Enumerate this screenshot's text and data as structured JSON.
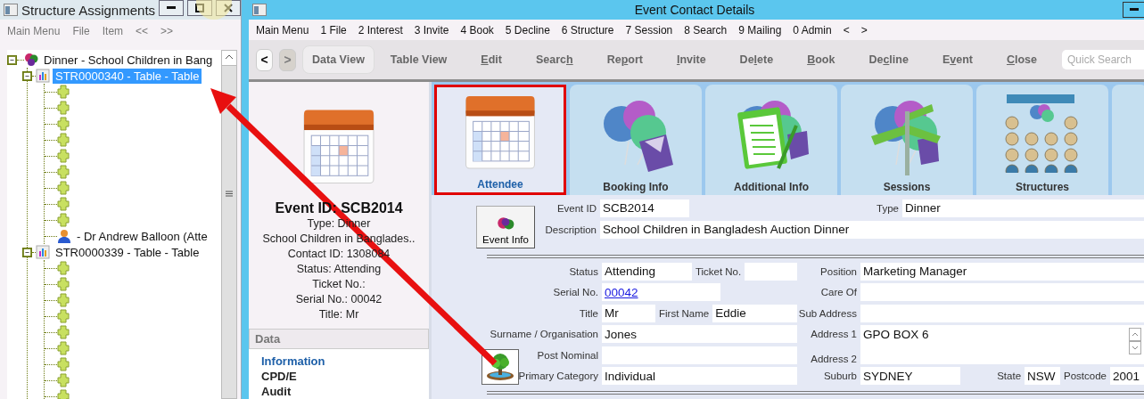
{
  "structure_window": {
    "title": "Structure Assignments",
    "menu": [
      "Main Menu",
      "File",
      "Item",
      "<<",
      ">>"
    ],
    "tree": [
      {
        "kind": "event",
        "label": "Dinner - School Children in Bang",
        "expanded": true,
        "selected": false,
        "children": [
          {
            "kind": "table",
            "label": "STR0000340 - Table - Table",
            "expanded": true,
            "selected": true,
            "children": [
              {
                "kind": "seat"
              },
              {
                "kind": "seat"
              },
              {
                "kind": "seat"
              },
              {
                "kind": "seat"
              },
              {
                "kind": "seat"
              },
              {
                "kind": "seat"
              },
              {
                "kind": "seat"
              },
              {
                "kind": "seat"
              },
              {
                "kind": "seat"
              },
              {
                "kind": "person",
                "label": "- Dr Andrew Balloon (Atte"
              }
            ]
          },
          {
            "kind": "table",
            "label": "STR0000339 - Table - Table",
            "expanded": true,
            "selected": false,
            "children": [
              {
                "kind": "seat"
              },
              {
                "kind": "seat"
              },
              {
                "kind": "seat"
              },
              {
                "kind": "seat"
              },
              {
                "kind": "seat"
              },
              {
                "kind": "seat"
              },
              {
                "kind": "seat"
              },
              {
                "kind": "seat"
              },
              {
                "kind": "seat"
              }
            ]
          }
        ]
      }
    ]
  },
  "window": {
    "title": "Event Contact Details"
  },
  "menu": [
    "Main Menu",
    "1 File",
    "2 Interest",
    "3 Invite",
    "4 Book",
    "5 Decline",
    "6 Structure",
    "7 Session",
    "8 Search",
    "9 Mailing",
    "0 Admin",
    "<",
    ">"
  ],
  "toolbar": {
    "nav": [
      {
        "label": "<",
        "disabled": false
      },
      {
        "label": ">",
        "disabled": true
      }
    ],
    "buttons": [
      {
        "parts": [
          {
            "text": "Data View",
            "underlined": false
          }
        ],
        "selected": true
      },
      {
        "parts": [
          {
            "text": "Table View",
            "underlined": false
          }
        ],
        "selected": false
      },
      {
        "parts": [
          {
            "text": "E",
            "underlined": true
          },
          {
            "text": "dit",
            "underlined": false
          }
        ],
        "selected": false
      },
      {
        "parts": [
          {
            "text": "Searc",
            "underlined": false
          },
          {
            "text": "h",
            "underlined": true
          }
        ],
        "selected": false
      },
      {
        "parts": [
          {
            "text": "Re",
            "underlined": false
          },
          {
            "text": "p",
            "underlined": true
          },
          {
            "text": "ort",
            "underlined": false
          }
        ],
        "selected": false
      },
      {
        "parts": [
          {
            "text": "I",
            "underlined": true
          },
          {
            "text": "nvite",
            "underlined": false
          }
        ],
        "selected": false
      },
      {
        "parts": [
          {
            "text": "De",
            "underlined": false
          },
          {
            "text": "l",
            "underlined": true
          },
          {
            "text": "ete",
            "underlined": false
          }
        ],
        "selected": false
      },
      {
        "parts": [
          {
            "text": "B",
            "underlined": true
          },
          {
            "text": "ook",
            "underlined": false
          }
        ],
        "selected": false
      },
      {
        "parts": [
          {
            "text": "De",
            "underlined": false
          },
          {
            "text": "c",
            "underlined": true
          },
          {
            "text": "line",
            "underlined": false
          }
        ],
        "selected": false
      },
      {
        "parts": [
          {
            "text": "E",
            "underlined": false
          },
          {
            "text": "v",
            "underlined": true
          },
          {
            "text": "ent",
            "underlined": false
          }
        ],
        "selected": false
      },
      {
        "parts": [
          {
            "text": "C",
            "underlined": true
          },
          {
            "text": "lose",
            "underlined": false
          }
        ],
        "selected": false
      }
    ],
    "quick_search": {
      "placeholder": "Quick Search"
    }
  },
  "summary": {
    "heading": "Event ID: SCB2014",
    "lines": [
      "Type: Dinner",
      "School Children in Banglades..",
      "Contact ID: 1308084",
      "Status: Attending",
      "Ticket No.:",
      "Serial No.: 00042",
      "Title: Mr"
    ]
  },
  "data_nav": {
    "title": "Data",
    "items": [
      {
        "label": "Information",
        "selected": true
      },
      {
        "label": "CPD/E",
        "selected": false
      },
      {
        "label": "Audit",
        "selected": false
      }
    ]
  },
  "tabs": [
    {
      "label": "Attendee",
      "kind": "calendar",
      "selected": true
    },
    {
      "label": "Booking Info",
      "kind": "balloons",
      "selected": false
    },
    {
      "label": "Additional Info",
      "kind": "clipboard",
      "selected": false
    },
    {
      "label": "Sessions",
      "kind": "signpost",
      "selected": false
    },
    {
      "label": "Structures",
      "kind": "seating",
      "selected": false
    }
  ],
  "event_info_button": {
    "label": "Event Info"
  },
  "form": {
    "event_id": {
      "label": "Event ID",
      "value": "SCB2014"
    },
    "type": {
      "label": "Type",
      "value": "Dinner"
    },
    "description": {
      "label": "Description",
      "value": "School Children in Bangladesh Auction Dinner"
    },
    "status": {
      "label": "Status",
      "value": "Attending"
    },
    "ticket_no": {
      "label": "Ticket No."
    },
    "serial_no": {
      "label": "Serial No.",
      "value": "00042"
    },
    "title": {
      "label": "Title",
      "value": "Mr"
    },
    "first_name": {
      "label": "First Name",
      "value": "Eddie"
    },
    "surname": {
      "label": "Surname / Organisation",
      "value": "Jones"
    },
    "post_nominal": {
      "label": "Post Nominal"
    },
    "primary_category": {
      "label": "Primary Category",
      "value": "Individual"
    },
    "position": {
      "label": "Position",
      "value": "Marketing Manager"
    },
    "care_of": {
      "label": "Care Of"
    },
    "sub_address": {
      "label": "Sub Address"
    },
    "address": {
      "label_1": "Address 1",
      "label_2": "Address 2",
      "value": "GPO BOX 6"
    },
    "suburb": {
      "label": "Suburb",
      "value": "SYDNEY"
    },
    "state": {
      "label": "State",
      "value": "NSW"
    },
    "postcode": {
      "label": "Postcode",
      "value": "2001"
    }
  }
}
